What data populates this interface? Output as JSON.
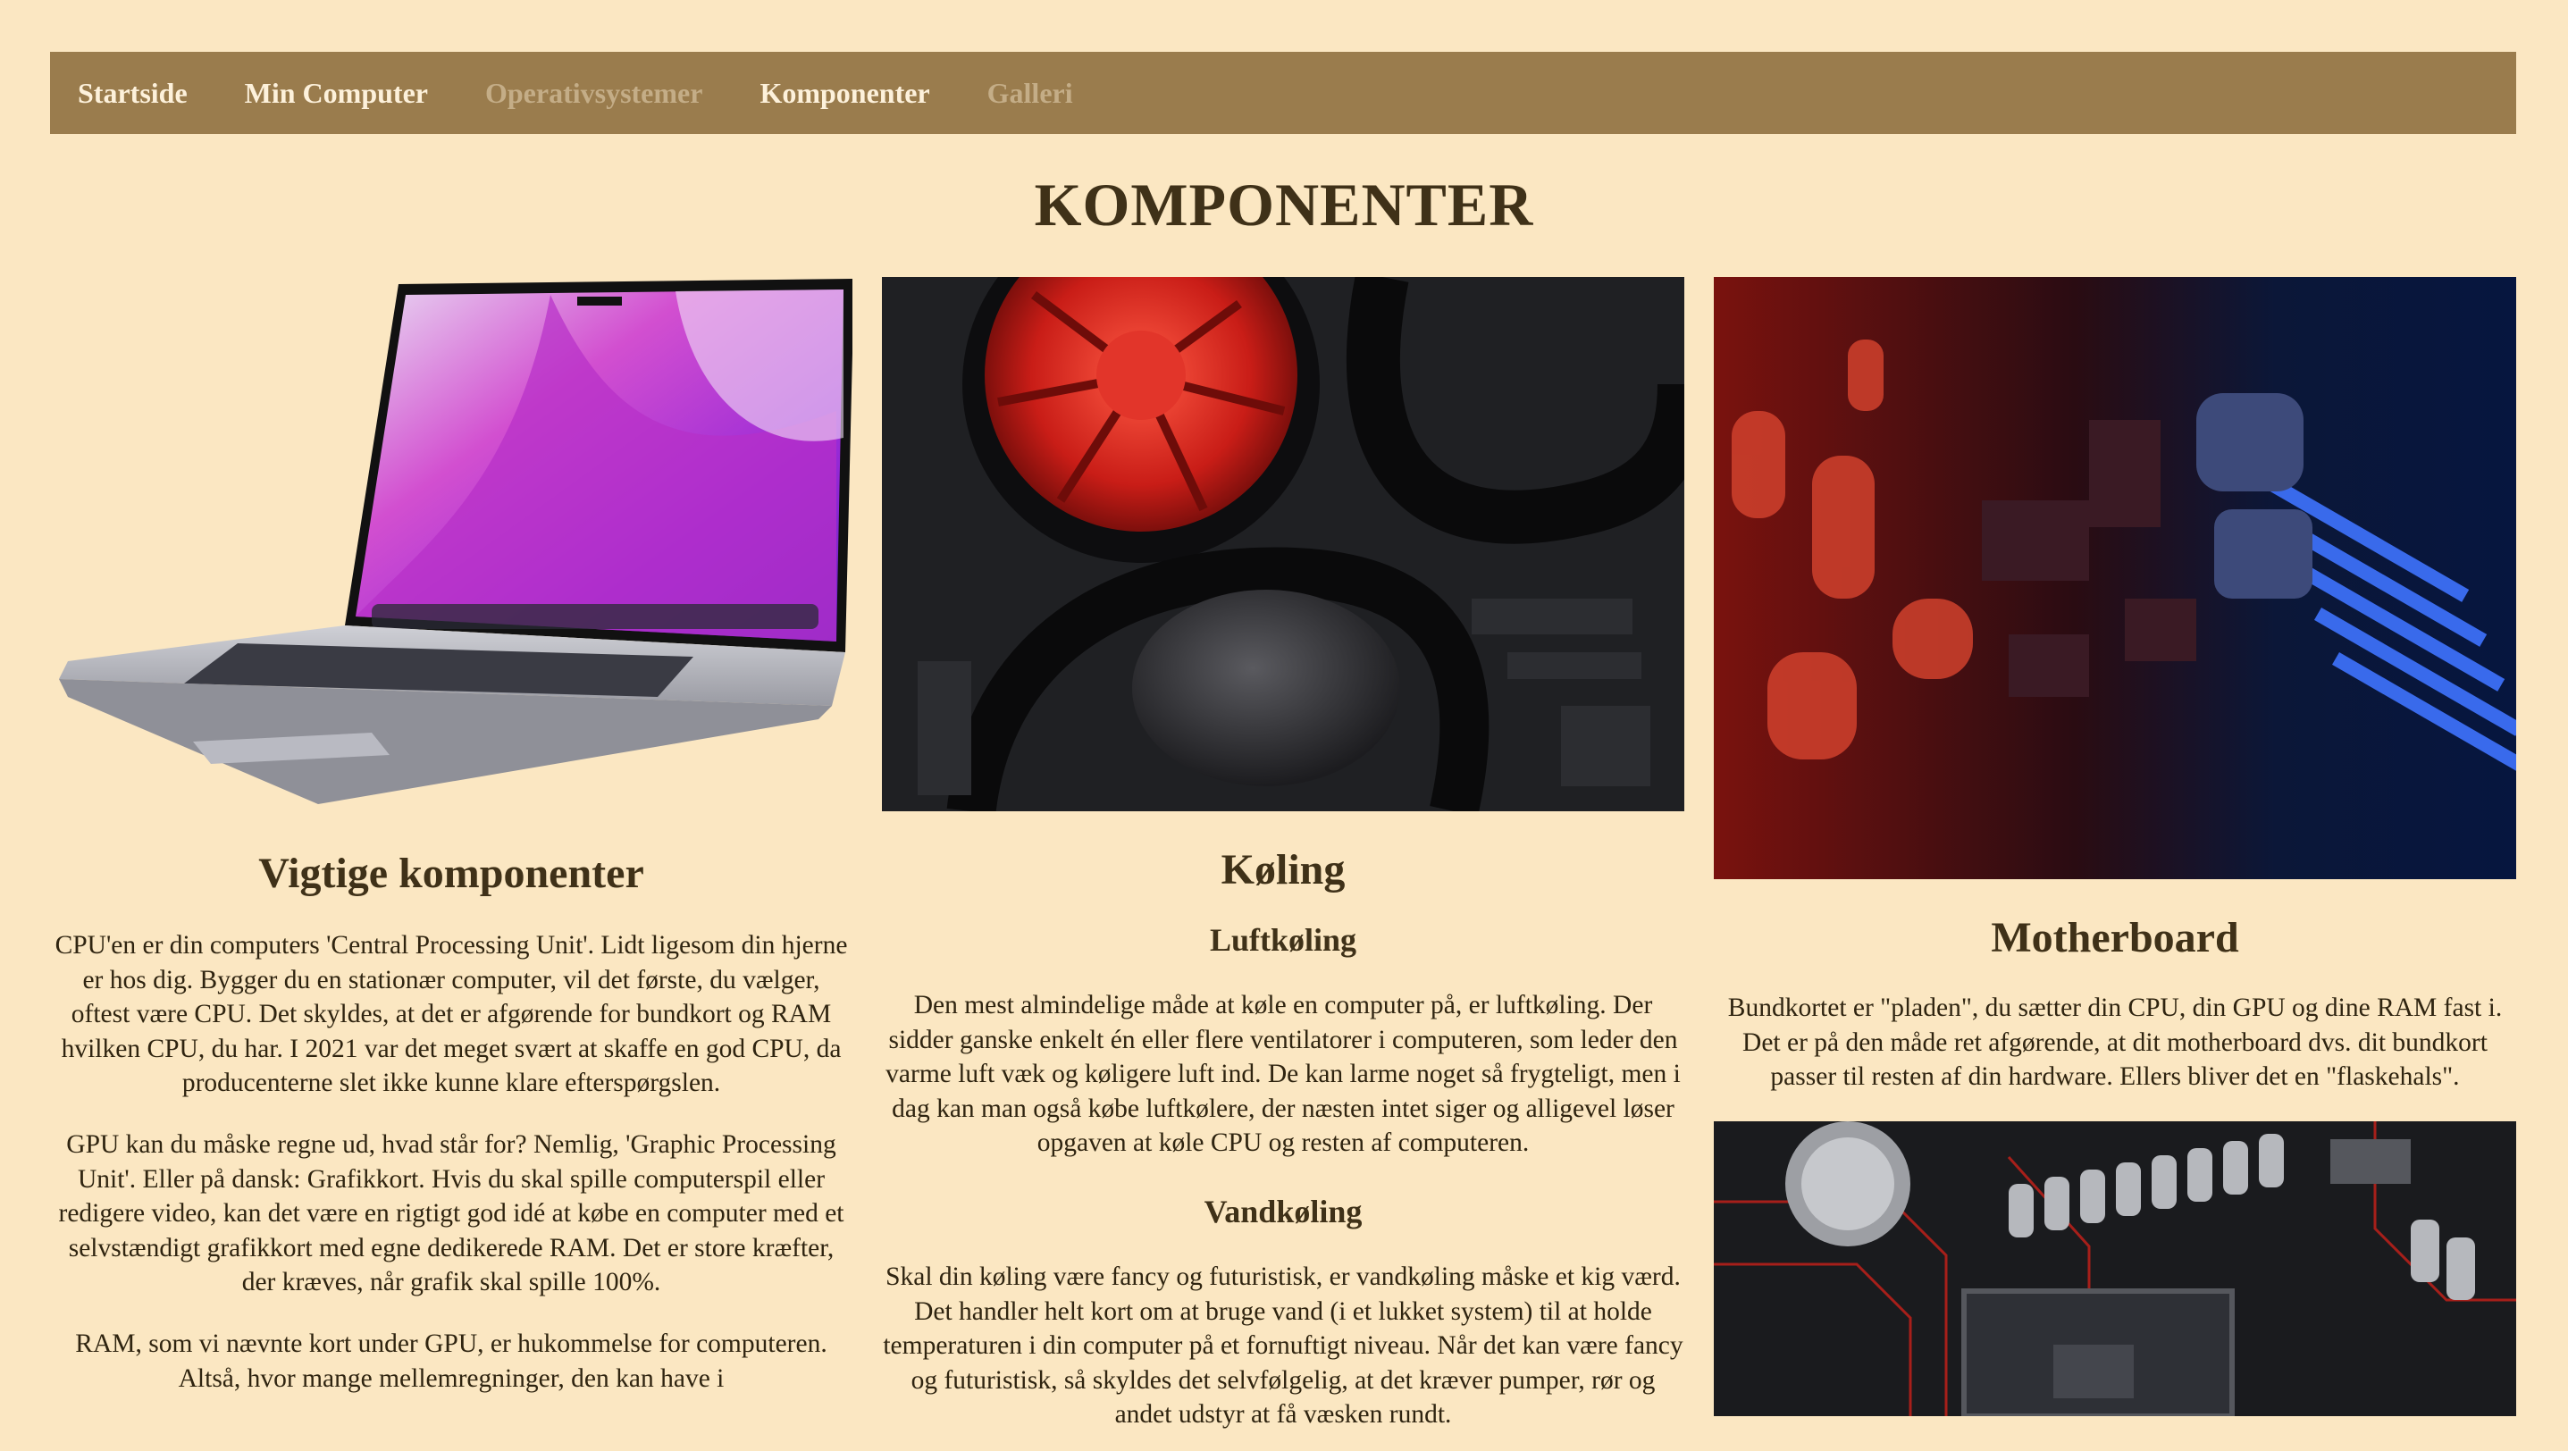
{
  "nav": {
    "items": [
      {
        "label": "Startside"
      },
      {
        "label": "Min Computer"
      },
      {
        "label": "Operativsystemer"
      },
      {
        "label": "Komponenter"
      },
      {
        "label": "Galleri"
      }
    ]
  },
  "page": {
    "title": "KOMPONENTER"
  },
  "columns": {
    "vigtige": {
      "heading": "Vigtige komponenter",
      "p1": "CPU'en er din computers 'Central Processing Unit'. Lidt ligesom din hjerne er hos dig. Bygger du en stationær computer, vil det første, du vælger, oftest være CPU. Det skyldes, at det er afgørende for bundkort og RAM hvilken CPU, du har. I 2021 var det meget svært at skaffe en god CPU, da producenterne slet ikke kunne klare efterspørgslen.",
      "p2": "GPU kan du måske regne ud, hvad står for? Nemlig, 'Graphic Processing Unit'. Eller på dansk: Grafikkort. Hvis du skal spille computerspil eller redigere video, kan det være en rigtigt god idé at købe en computer med et selvstændigt grafikkort med egne dedikerede RAM. Det er store kræfter, der kræves, når grafik skal spille 100%.",
      "p3": "RAM, som vi nævnte kort under GPU, er hukommelse for computeren. Altså, hvor mange mellemregninger, den kan have i"
    },
    "koling": {
      "heading": "Køling",
      "sub1": "Luftkøling",
      "p1": "Den mest almindelige måde at køle en computer på, er luftkøling. Der sidder ganske enkelt én eller flere ventilatorer i computeren, som leder den varme luft væk og køligere luft ind. De kan larme noget så frygteligt, men i dag kan man også købe luftkølere, der næsten intet siger og alligevel løser opgaven at køle CPU og resten af computeren.",
      "sub2": "Vandkøling",
      "p2": "Skal din køling være fancy og futuristisk, er vandkøling måske et kig værd. Det handler helt kort om at bruge vand (i et lukket system) til at holde temperaturen i din computer på et fornuftigt niveau. Når det kan være fancy og futuristisk, så skyldes det selvfølgelig, at det kræver pumper, rør og andet udstyr at få væsken rundt."
    },
    "motherboard": {
      "heading": "Motherboard",
      "p1": "Bundkortet er \"pladen\", du sætter din CPU, din GPU og dine RAM fast i. Det er på den måde ret afgørende, at dit motherboard dvs. dit bundkort passer til resten af din hardware. Ellers bliver det en \"flaskehals\"."
    }
  },
  "colors": {
    "background": "#fbe7c2",
    "nav": "#9a7c4d",
    "nav_text": "#fdf1db",
    "nav_muted": "#c4ad87",
    "heading": "#3f3118"
  },
  "images": [
    "laptop-image",
    "cooling-image",
    "motherboard-image",
    "motherboard-socket-image"
  ]
}
